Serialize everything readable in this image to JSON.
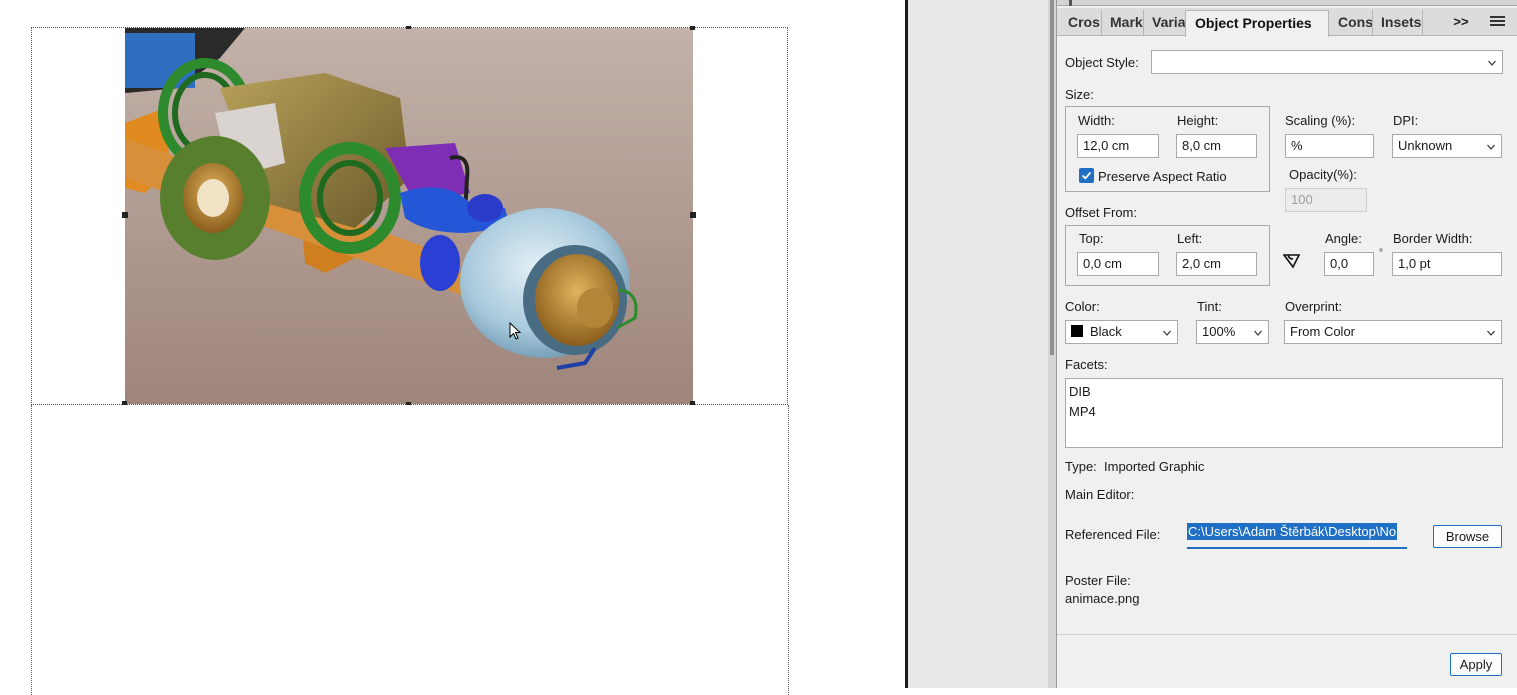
{
  "tabs": [
    {
      "label": "Cros"
    },
    {
      "label": "Mark"
    },
    {
      "label": "Varia"
    },
    {
      "label": "Object Properties"
    },
    {
      "label": "Cons"
    },
    {
      "label": "Insets"
    }
  ],
  "tab_overflow": ">>",
  "object_style": {
    "label": "Object Style:",
    "value": ""
  },
  "size": {
    "label": "Size:",
    "width_label": "Width:",
    "width_value": "12,0 cm",
    "height_label": "Height:",
    "height_value": "8,0 cm",
    "preserve_label": "Preserve Aspect Ratio",
    "preserve_checked": true
  },
  "scaling": {
    "label": "Scaling (%):",
    "value": "%"
  },
  "dpi": {
    "label": "DPI:",
    "value": "Unknown"
  },
  "opacity": {
    "label": "Opacity(%):",
    "value": "100"
  },
  "offset": {
    "label": "Offset From:",
    "top_label": "Top:",
    "top_value": "0,0 cm",
    "left_label": "Left:",
    "left_value": "2,0 cm"
  },
  "angle": {
    "label": "Angle:",
    "value": "0,0",
    "unit": "°"
  },
  "border_width": {
    "label": "Border Width:",
    "value": "1,0 pt"
  },
  "color": {
    "label": "Color:",
    "value": "Black",
    "swatch": "#000000"
  },
  "tint": {
    "label": "Tint:",
    "value": "100%"
  },
  "overprint": {
    "label": "Overprint:",
    "value": "From Color"
  },
  "facets": {
    "label": "Facets:",
    "items": [
      "DIB",
      "MP4"
    ]
  },
  "type": {
    "label": "Type:",
    "value": "Imported Graphic"
  },
  "main_editor": {
    "label": "Main Editor:"
  },
  "referenced_file": {
    "label": "Referenced File:",
    "value": "C:\\Users\\Adam Štěrbák\\Desktop\\No"
  },
  "browse_label": "Browse",
  "poster_file": {
    "label": "Poster File:",
    "value": "animace.png"
  },
  "apply_label": "Apply",
  "colors": {
    "accent": "#1f6fc5",
    "panel_bg": "#f0f0f0",
    "tabbar_bg": "#dcdcdc"
  }
}
